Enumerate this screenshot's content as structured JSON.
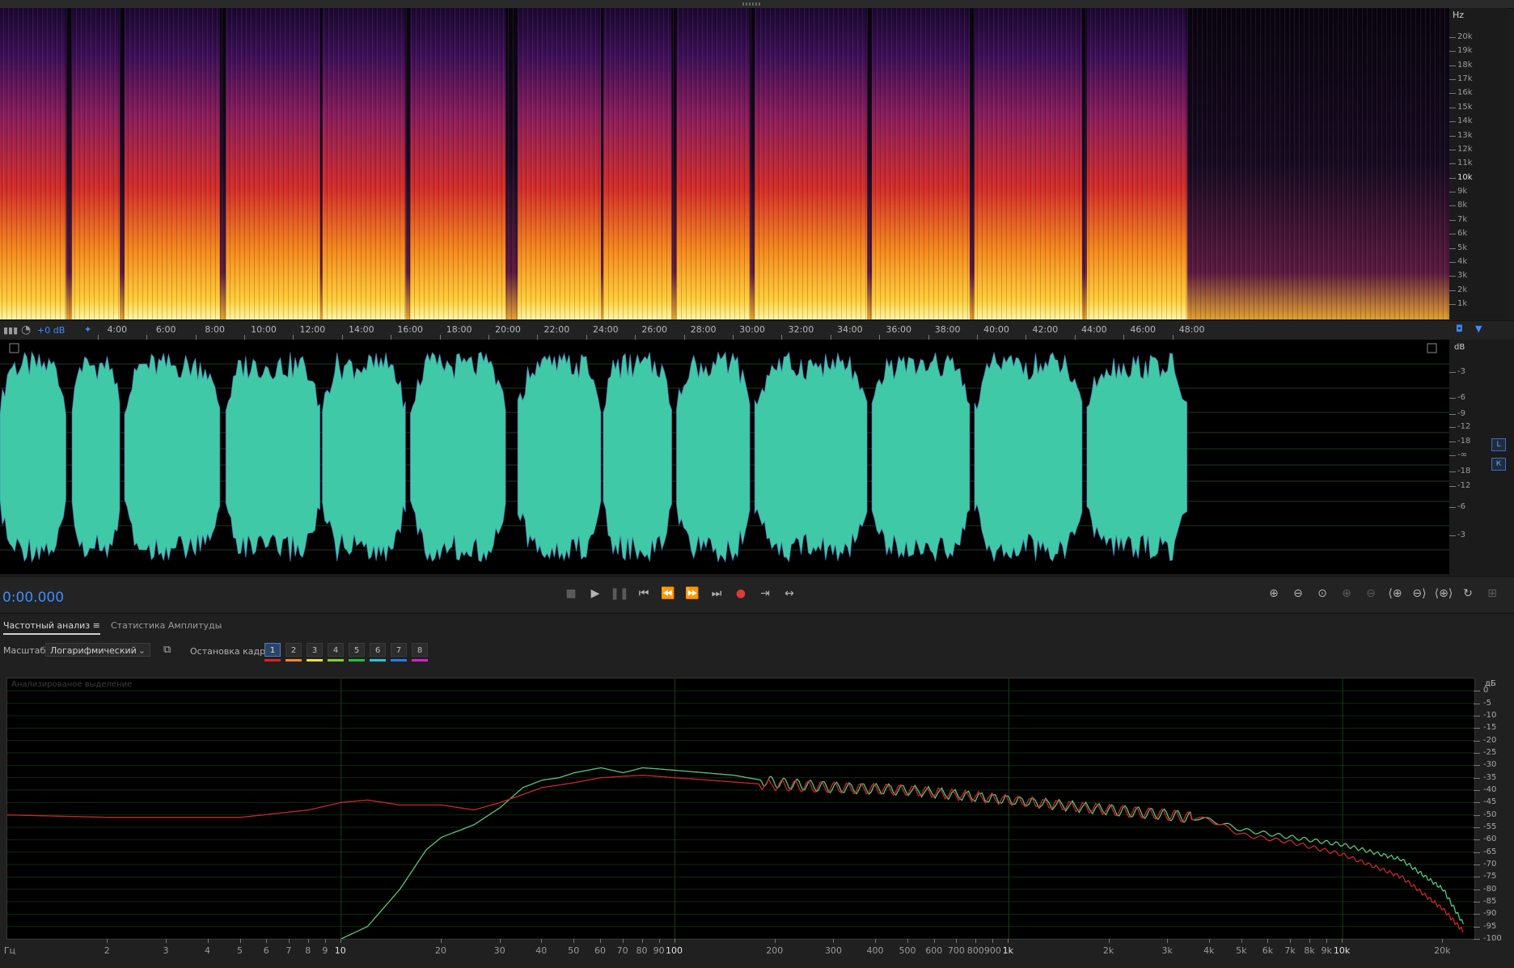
{
  "spectral": {
    "unit": "Hz",
    "labels": [
      "20k",
      "19k",
      "18k",
      "17k",
      "16k",
      "15k",
      "14k",
      "13k",
      "12k",
      "11k",
      "10k",
      "9k",
      "8k",
      "7k",
      "6k",
      "5k",
      "4k",
      "3k",
      "2k",
      "1k"
    ],
    "bold_label": "10k"
  },
  "timebar": {
    "gain": "+0 dB",
    "labels": [
      "4:00",
      "6:00",
      "8:00",
      "10:00",
      "12:00",
      "14:00",
      "16:00",
      "18:00",
      "20:00",
      "22:00",
      "24:00",
      "26:00",
      "28:00",
      "30:00",
      "32:00",
      "34:00",
      "36:00",
      "38:00",
      "40:00",
      "42:00",
      "44:00",
      "46:00",
      "48:00"
    ]
  },
  "waveform": {
    "unit": "dB",
    "labels": [
      "-3",
      "-6",
      "-9",
      "-12",
      "-18",
      "-∞",
      "-18",
      "-12",
      "-6",
      "-3"
    ],
    "channel_left": "L",
    "channel_right": "К",
    "color": "#40c9a6",
    "segments": [
      {
        "start": 0.0,
        "end": 2.7
      },
      {
        "start": 2.95,
        "end": 4.9
      },
      {
        "start": 5.1,
        "end": 9.0
      },
      {
        "start": 9.25,
        "end": 13.1
      },
      {
        "start": 13.2,
        "end": 16.6
      },
      {
        "start": 16.8,
        "end": 20.7
      },
      {
        "start": 21.2,
        "end": 24.6
      },
      {
        "start": 24.7,
        "end": 27.5
      },
      {
        "start": 27.7,
        "end": 30.7
      },
      {
        "start": 30.9,
        "end": 35.5
      },
      {
        "start": 35.7,
        "end": 39.7
      },
      {
        "start": 39.9,
        "end": 44.3
      },
      {
        "start": 44.5,
        "end": 48.6
      }
    ]
  },
  "transport": {
    "timecode": "0:00.000",
    "record_color": "#e03a3a"
  },
  "panel": {
    "tabs": [
      "Частотный анализ ≡",
      "Статистика Амплитуды"
    ],
    "scale_label": "Масштаб:",
    "scale_value": "Логарифмический",
    "freeze_label": "Остановка кадра:",
    "freeze_buttons": [
      "1",
      "2",
      "3",
      "4",
      "5",
      "6",
      "7",
      "8"
    ],
    "freeze_colors": [
      "#e02020",
      "#f08a1c",
      "#f0e020",
      "#8ad020",
      "#20c040",
      "#20c8e0",
      "#2080e8",
      "#d020d0"
    ],
    "graph_caption": "Анализированое выделение"
  },
  "freq_graph": {
    "db_unit": "дБ",
    "db_labels": [
      "0",
      "-5",
      "-10",
      "-15",
      "-20",
      "-25",
      "-30",
      "-35",
      "-40",
      "-45",
      "-50",
      "-55",
      "-60",
      "-65",
      "-70",
      "-75",
      "-80",
      "-85",
      "-90",
      "-95",
      "-100"
    ],
    "x_unit": "Гц",
    "x_labels": [
      "2",
      "3",
      "4",
      "5",
      "6",
      "7",
      "8",
      "9",
      "10",
      "20",
      "30",
      "40",
      "50",
      "60",
      "70",
      "80",
      "90",
      "100",
      "200",
      "300",
      "400",
      "500",
      "600",
      "700",
      "800",
      "900",
      "1k",
      "2k",
      "3k",
      "4k",
      "5k",
      "6k",
      "7k",
      "8k",
      "9k",
      "10k",
      "20k"
    ],
    "bold_x_labels": [
      "10",
      "100",
      "1k",
      "10k"
    ]
  },
  "chart_data": {
    "type": "line",
    "xlabel": "Гц",
    "ylabel": "дБ",
    "xscale": "log",
    "xlim": [
      1,
      24000
    ],
    "ylim": [
      -100,
      5
    ],
    "series": [
      {
        "color": "#5fc47a",
        "x": [
          10,
          12,
          15,
          18,
          20,
          25,
          30,
          35,
          40,
          45,
          50,
          60,
          70,
          80,
          100,
          150,
          200,
          300,
          500,
          1000,
          2000,
          3000,
          4000,
          5000,
          7000,
          10000,
          15000,
          20000,
          23000
        ],
        "y": [
          -100,
          -95,
          -80,
          -64,
          -59,
          -54,
          -47,
          -39,
          -36,
          -35,
          -33,
          -31,
          -33,
          -31,
          -32,
          -34,
          -37,
          -39,
          -40,
          -44,
          -48,
          -50,
          -52,
          -56,
          -59,
          -62,
          -68,
          -80,
          -94
        ]
      },
      {
        "color": "#c8282a",
        "x": [
          1,
          2,
          5,
          8,
          10,
          12,
          15,
          20,
          25,
          30,
          40,
          50,
          60,
          80,
          100,
          200,
          300,
          500,
          1000,
          2000,
          3000,
          4000,
          5000,
          7000,
          10000,
          15000,
          20000,
          23000
        ],
        "y": [
          -50,
          -51,
          -51,
          -48,
          -45,
          -44,
          -46,
          -46,
          -48,
          -45,
          -39,
          -37,
          -35,
          -34,
          -35,
          -38,
          -39,
          -40,
          -44,
          -48,
          -50,
          -52,
          -58,
          -61,
          -66,
          -75,
          -88,
          -97
        ]
      }
    ]
  }
}
